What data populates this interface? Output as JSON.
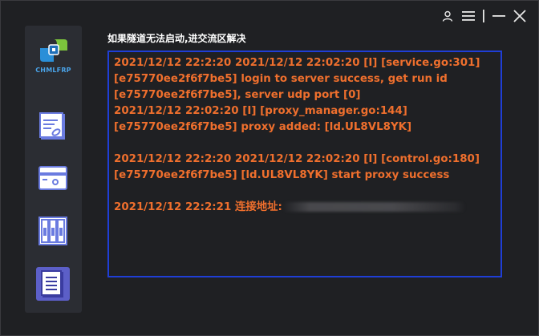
{
  "window": {
    "controls": [
      {
        "name": "user-icon"
      },
      {
        "name": "menu-icon"
      },
      {
        "name": "minimize-icon"
      },
      {
        "name": "close-icon"
      }
    ]
  },
  "sidebar": {
    "logo_text": "CHMLFRP",
    "items": [
      {
        "name": "tunnel-list",
        "icon": "document-clip-icon"
      },
      {
        "name": "add-tunnel",
        "icon": "card-icon"
      },
      {
        "name": "servers",
        "icon": "server-racks-icon"
      },
      {
        "name": "logs",
        "icon": "log-document-icon",
        "active": true
      }
    ]
  },
  "main": {
    "title": "如果隧道无法启动,进交流区解决",
    "log_lines": [
      "2021/12/12 22:2:20 2021/12/12 22:02:20 [I] [service.go:301]",
      "[e75770ee2f6f7be5] login to server success, get run id",
      "[e75770ee2f6f7be5], server udp port [0]",
      "2021/12/12 22:02:20 [I] [proxy_manager.go:144]",
      "[e75770ee2f6f7be5] proxy added: [ld.UL8VL8YK]",
      "",
      "2021/12/12 22:2:20 2021/12/12 22:02:20 [I] [control.go:180]",
      "[e75770ee2f6f7be5] [ld.UL8VL8YK] start proxy success",
      ""
    ],
    "last_line_prefix": "2021/12/12 22:2:21 连接地址:"
  },
  "colors": {
    "accent": "#5c5fc8",
    "log_text": "#ef6f2d",
    "log_border": "#1f3ed6"
  }
}
